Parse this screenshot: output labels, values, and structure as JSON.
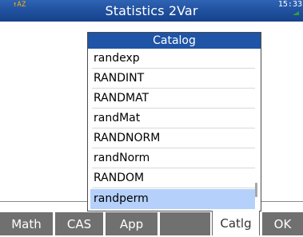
{
  "app": {
    "title": "Statistics 2Var",
    "status_indicator": "↑AZ",
    "time": "15:33",
    "colors": {
      "title_bar": "#1f4f9d",
      "menu_header": "#1f54a6",
      "selected_row": "#b5d1fb",
      "softkey": "#707070",
      "status_alpha": "#ffb300",
      "battery": "#2ea23a"
    }
  },
  "catalog": {
    "title": "Catalog",
    "items": [
      {
        "label": "randexp"
      },
      {
        "label": "RANDINT"
      },
      {
        "label": "RANDMAT"
      },
      {
        "label": "randMat"
      },
      {
        "label": "RANDNORM"
      },
      {
        "label": "randNorm"
      },
      {
        "label": "RANDOM"
      },
      {
        "label": "randperm"
      }
    ],
    "selected": "randperm"
  },
  "softkeys": {
    "math": "Math",
    "cas": "CAS",
    "app": "App",
    "blank4": "",
    "catlg": "Catlg",
    "ok": "OK"
  }
}
